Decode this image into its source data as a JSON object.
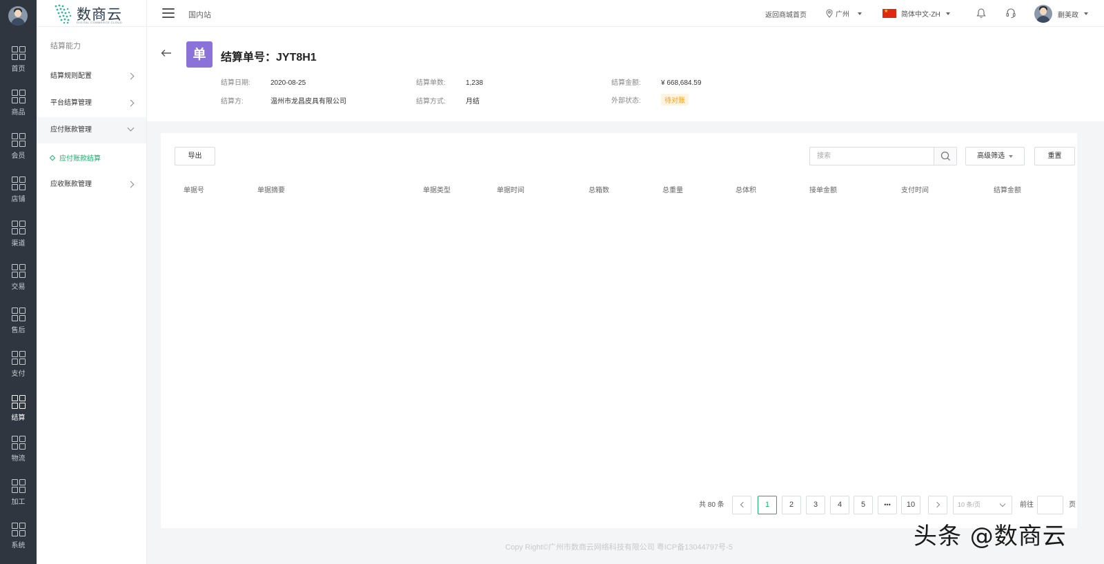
{
  "rail": {
    "items": [
      {
        "label": "首页"
      },
      {
        "label": "商品"
      },
      {
        "label": "会员"
      },
      {
        "label": "店铺"
      },
      {
        "label": "渠道"
      },
      {
        "label": "交易"
      },
      {
        "label": "售后"
      },
      {
        "label": "支付"
      },
      {
        "label": "结算",
        "active": true
      },
      {
        "label": "物流"
      },
      {
        "label": "加工"
      },
      {
        "label": "系统"
      }
    ]
  },
  "header": {
    "logo_name": "数商云",
    "logo_sub": "DIGITAL COMMERCE CLOUD",
    "site": "国内站",
    "back_mall": "返回商城首页",
    "city": "广州",
    "language": "简体中文-ZH",
    "username": "蒯美政"
  },
  "subnav": {
    "title": "结算能力",
    "items": [
      {
        "label": "结算规则配置"
      },
      {
        "label": "平台结算管理"
      },
      {
        "label": "应付账款管理",
        "open": true
      },
      {
        "label": "应收账款管理"
      }
    ],
    "active_subitem": "应付账款结算"
  },
  "detail": {
    "icon_char": "单",
    "title": "结算单号：JYT8H1",
    "fields": {
      "date_key": "结算日期:",
      "date_val": "2020-08-25",
      "count_key": "结算单数:",
      "count_val": "1,238",
      "amount_key": "结算金额:",
      "amount_val": "¥ 668,684.59",
      "party_key": "结算方:",
      "party_val": "温州市龙昌皮具有限公司",
      "method_key": "结算方式:",
      "method_val": "月结",
      "status_key": "外部状态:",
      "status_val": "待对账"
    }
  },
  "toolbar": {
    "export_label": "导出",
    "search_placeholder": "搜索",
    "advanced_filter_label": "高级筛选",
    "reset_label": "重置"
  },
  "table": {
    "columns": [
      "单据号",
      "单据摘要",
      "单据类型",
      "单据时间",
      "总箱数",
      "总重量",
      "总体积",
      "接单金额",
      "支付时间",
      "结算金额"
    ],
    "rows": []
  },
  "pagination": {
    "total": "共 80 条",
    "pages": [
      "1",
      "2",
      "3",
      "4",
      "5",
      "•••",
      "10"
    ],
    "current": "1",
    "page_size": "10 条/页",
    "goto_label": "前往",
    "page_unit": "页"
  },
  "footer": {
    "copyright": "Copy Right©广州市数商云网络科技有限公司 粤ICP备13044797号-5"
  },
  "watermark": {
    "text": "头条 @数商云"
  },
  "colors": {
    "rail_bg": "#2f3640",
    "accent_green": "#17b26a",
    "badge_purple": "#8b72d9",
    "status_orange": "#f7a01f"
  }
}
